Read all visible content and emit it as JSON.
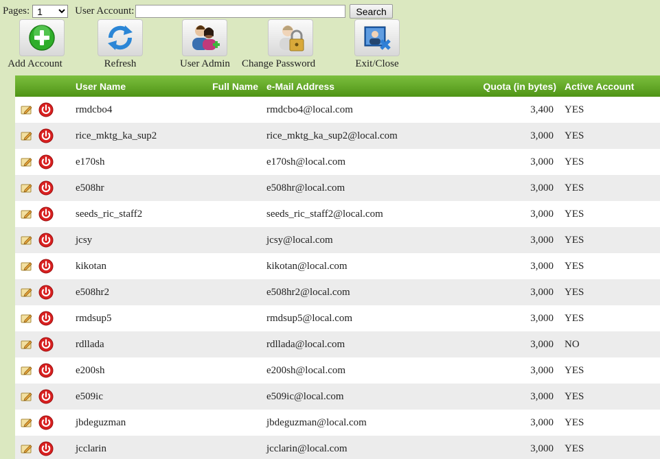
{
  "search": {
    "pages_label": "Pages:",
    "pages_value": "1",
    "user_account_label": "User Account:",
    "user_account_value": "",
    "search_label": "Search"
  },
  "toolbar": {
    "add_account": "Add Account",
    "refresh": "Refresh",
    "user_admin": "User Admin",
    "change_password": "Change Password",
    "exit_close": "Exit/Close"
  },
  "table": {
    "headers": {
      "user_name": "User Name",
      "full_name": "Full Name",
      "email": "e-Mail Address",
      "quota": "Quota (in bytes)",
      "active": "Active Account"
    },
    "rows": [
      {
        "user": "rmdcbo4",
        "full": "",
        "email": "rmdcbo4@local.com",
        "quota": "3,400",
        "active": "YES"
      },
      {
        "user": "rice_mktg_ka_sup2",
        "full": "",
        "email": "rice_mktg_ka_sup2@local.com",
        "quota": "3,000",
        "active": "YES"
      },
      {
        "user": "e170sh",
        "full": "",
        "email": "e170sh@local.com",
        "quota": "3,000",
        "active": "YES"
      },
      {
        "user": "e508hr",
        "full": "",
        "email": "e508hr@local.com",
        "quota": "3,000",
        "active": "YES"
      },
      {
        "user": "seeds_ric_staff2",
        "full": "",
        "email": "seeds_ric_staff2@local.com",
        "quota": "3,000",
        "active": "YES"
      },
      {
        "user": "jcsy",
        "full": "",
        "email": "jcsy@local.com",
        "quota": "3,000",
        "active": "YES"
      },
      {
        "user": "kikotan",
        "full": "",
        "email": "kikotan@local.com",
        "quota": "3,000",
        "active": "YES"
      },
      {
        "user": "e508hr2",
        "full": "",
        "email": "e508hr2@local.com",
        "quota": "3,000",
        "active": "YES"
      },
      {
        "user": "rmdsup5",
        "full": "",
        "email": "rmdsup5@local.com",
        "quota": "3,000",
        "active": "YES"
      },
      {
        "user": "rdllada",
        "full": "",
        "email": "rdllada@local.com",
        "quota": "3,000",
        "active": "NO"
      },
      {
        "user": "e200sh",
        "full": "",
        "email": "e200sh@local.com",
        "quota": "3,000",
        "active": "YES"
      },
      {
        "user": "e509ic",
        "full": "",
        "email": "e509ic@local.com",
        "quota": "3,000",
        "active": "YES"
      },
      {
        "user": "jbdeguzman",
        "full": "",
        "email": "jbdeguzman@local.com",
        "quota": "3,000",
        "active": "YES"
      },
      {
        "user": "jcclarin",
        "full": "",
        "email": "jcclarin@local.com",
        "quota": "3,000",
        "active": "YES"
      }
    ]
  },
  "icons": {
    "add": "add-account-icon",
    "refresh": "refresh-icon",
    "user_admin": "user-admin-icon",
    "change_password": "lock-user-icon",
    "exit": "exit-icon",
    "row_edit": "edit-icon",
    "row_disable": "power-icon"
  },
  "colors": {
    "background": "#dbe8c0",
    "header_green": "#5fa526",
    "row_alt": "#ececec",
    "power_red": "#d82020"
  }
}
